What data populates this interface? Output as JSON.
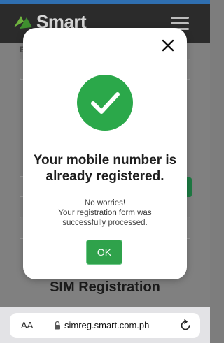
{
  "header": {
    "brand_name": "Smart",
    "menu_icon": "hamburger-menu-icon",
    "accent_color": "#2f6fb0"
  },
  "page": {
    "field_label_fragment": "E",
    "title": "SIM Registration"
  },
  "modal": {
    "close_icon": "close-icon",
    "status_icon": "check-circle-icon",
    "title_line1": "Your mobile number is",
    "title_line2": "already registered.",
    "message_line1": "No worries!",
    "message_line2": "Your registration form was",
    "message_line3": "successfully processed.",
    "ok_label": "OK",
    "success_color": "#2ba84a"
  },
  "browser": {
    "text_size_label": "AA",
    "url": "simreg.smart.com.ph",
    "lock_icon": "lock-icon",
    "reload_icon": "reload-icon"
  }
}
